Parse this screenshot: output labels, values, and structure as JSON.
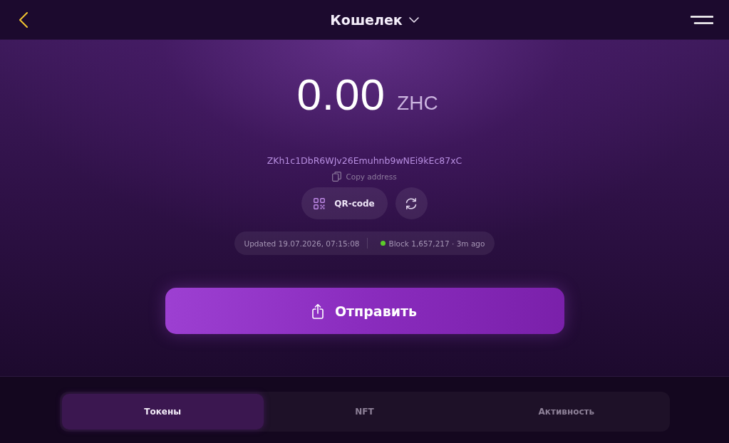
{
  "header": {
    "title": "Кошелек"
  },
  "balance": {
    "amount": "0.00",
    "currency": "ZHC"
  },
  "address": "ZKh1c1DbR6WJv26Emuhnb9wNEi9kEc87xC",
  "copy_label": "Copy address",
  "actions": [
    {
      "kind": "qr",
      "label": "QR-code"
    },
    {
      "kind": "refresh"
    }
  ],
  "status": {
    "updated": "Updated 19.07.2026, 07:15:08",
    "block": "Block 1,657,217 · 3m ago",
    "connected": true
  },
  "send_button": {
    "label": "Отправить"
  },
  "tabs": [
    {
      "label": "Токены",
      "selected": true
    },
    {
      "label": "NFT",
      "selected": false
    },
    {
      "label": "Активность",
      "selected": false
    }
  ]
}
